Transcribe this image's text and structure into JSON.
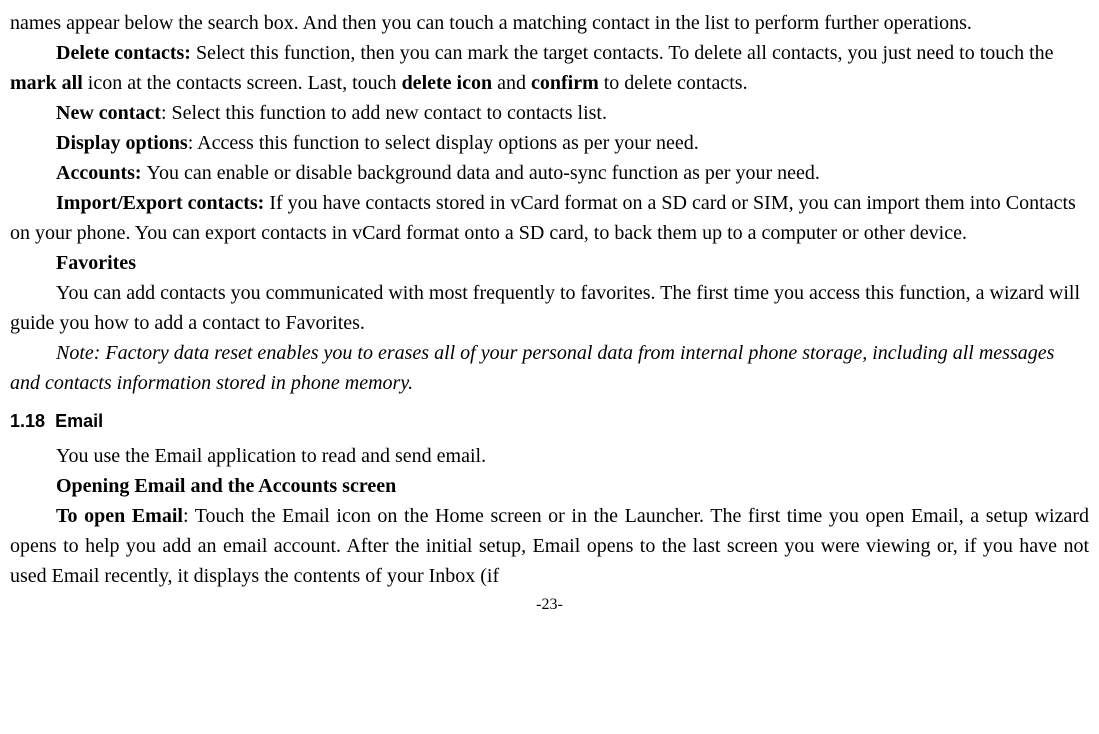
{
  "para_intro": "names appear below the search box. And then you can touch a matching contact in the list to perform further operations.",
  "delete_contacts": {
    "label": "Delete contacts: ",
    "text_a": "Select this function, then you can mark the target contacts. To delete all contacts, you just need to touch the ",
    "mark_all": "mark all",
    "text_b": " icon at the contacts screen. Last, touch ",
    "delete_icon": "delete icon",
    "text_c": " and ",
    "confirm": "confirm",
    "text_d": " to delete contacts."
  },
  "new_contact": {
    "label": "New contact",
    "text": ": Select this function to add new contact to contacts list."
  },
  "display_options": {
    "label": "Display options",
    "text": ": Access this function to select display options as per your need."
  },
  "accounts": {
    "label": "Accounts: ",
    "text": "You can enable or disable background data and auto-sync function as per your need."
  },
  "import_export": {
    "label": "Import/Export contacts: ",
    "text": "If you have contacts stored in vCard format on a SD card or SIM, you can import them into Contacts on your phone. You can export contacts in vCard format onto a SD card, to back them up to a computer or other device."
  },
  "favorites_label": "Favorites",
  "favorites_text": "You can add contacts you communicated with most frequently to favorites. The first time you access this function, a wizard will guide you how to add a contact to Favorites.",
  "note_text": "Note: Factory data reset enables you to erases all of your personal data from internal phone storage, including all messages and contacts information stored in phone memory.",
  "section": {
    "number": "1.18",
    "title": "Email"
  },
  "email_intro": "You use the Email application to read and send email.",
  "email_opening_heading": "Opening Email and the Accounts screen",
  "to_open_email": {
    "label": "To open Email",
    "text": ": Touch the Email icon on the Home screen or in the Launcher. The first time you open Email, a setup wizard opens to help you add an email account. After the initial setup, Email opens to the last screen you were viewing or, if you have not used Email recently, it displays the contents of your Inbox (if"
  },
  "page_number": "-23-"
}
